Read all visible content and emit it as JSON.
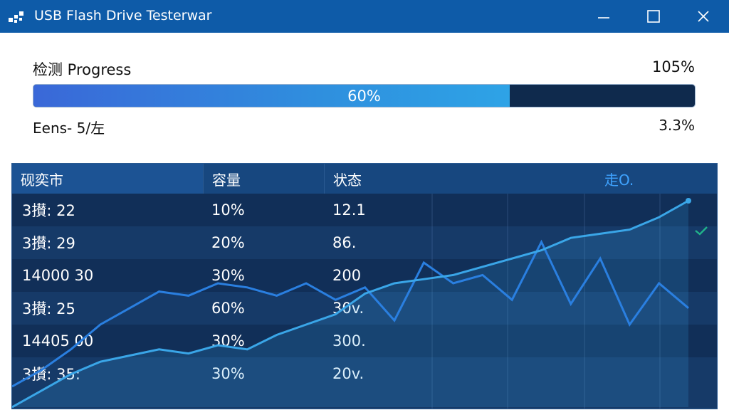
{
  "window": {
    "title": "USB Flash Drive Testerwar",
    "icon": "usb-app-icon",
    "controls": [
      "minimize-icon",
      "maximize-icon",
      "close-icon"
    ]
  },
  "progress": {
    "label": "检测 Progress",
    "percent_text": "105%",
    "bar_text": "60%",
    "fill_fraction": 0.72,
    "speed_label": "Eens- 5/左",
    "speed_value": "3.3%"
  },
  "table": {
    "headers": [
      "砚奕市",
      "容量",
      "状态",
      "走O."
    ],
    "rows": [
      [
        "3攅: 22",
        "10%",
        "12.1"
      ],
      [
        "3攅: 29",
        "20%",
        "86."
      ],
      [
        "14000 30",
        "30%",
        "200"
      ],
      [
        "3攅: 25",
        "60%",
        "30v."
      ],
      [
        "14405 00",
        "30%",
        "300."
      ],
      [
        "3攅: 35:",
        "30%",
        "20v."
      ]
    ],
    "check_icon": "check-icon"
  },
  "colors": {
    "titlebar": "#0e5ba8",
    "panel": "#0f2b52",
    "line1": "#3aa6e8",
    "line2": "#2a7fe0",
    "check": "#21b48a"
  },
  "chart_data": {
    "type": "line",
    "series": [
      {
        "values": [
          0,
          8,
          16,
          22,
          25,
          28,
          26,
          30,
          28,
          35,
          40,
          45,
          55,
          60,
          62,
          64,
          68,
          72,
          76,
          82,
          84,
          86,
          92,
          100
        ]
      },
      {
        "values": [
          10,
          18,
          28,
          40,
          48,
          56,
          54,
          60,
          58,
          54,
          60,
          52,
          58,
          42,
          70,
          60,
          64,
          52,
          80,
          50,
          72,
          40,
          60,
          48
        ]
      }
    ]
  }
}
